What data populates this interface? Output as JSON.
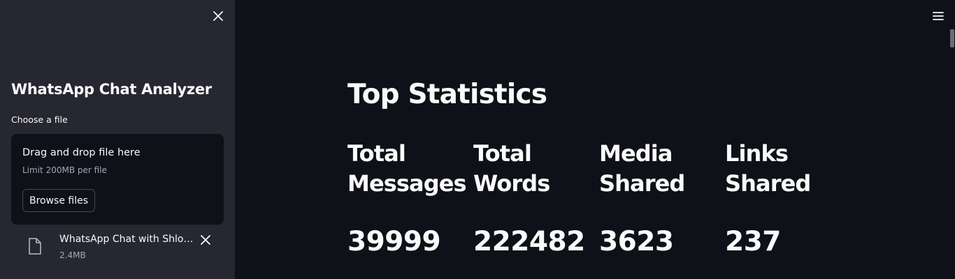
{
  "sidebar": {
    "title": "WhatsApp Chat Analyzer",
    "uploader": {
      "label": "Choose a file",
      "drop_text": "Drag and drop file here",
      "limit_text": "Limit 200MB per file",
      "browse_label": "Browse files"
    },
    "uploaded_file": {
      "name": "WhatsApp Chat with Shlok Singh Jadon.txt",
      "display_name": "WhatsApp Chat with Shlok ...",
      "size": "2.4MB",
      "icon": "file-icon"
    }
  },
  "main": {
    "title": "Top Statistics",
    "stats": [
      {
        "label": "Total Messages",
        "value": "39999"
      },
      {
        "label": "Total Words",
        "value": "222482"
      },
      {
        "label": "Media Shared",
        "value": "3623"
      },
      {
        "label": "Links Shared",
        "value": "237"
      }
    ]
  },
  "colors": {
    "main_bg": "#0e1117",
    "sidebar_bg": "#262730",
    "text": "#fafafa",
    "muted_text": "#a3a8b8"
  },
  "icons": {
    "sidebar_close": "close-icon",
    "menu": "hamburger-menu-icon",
    "file_remove": "close-icon"
  }
}
